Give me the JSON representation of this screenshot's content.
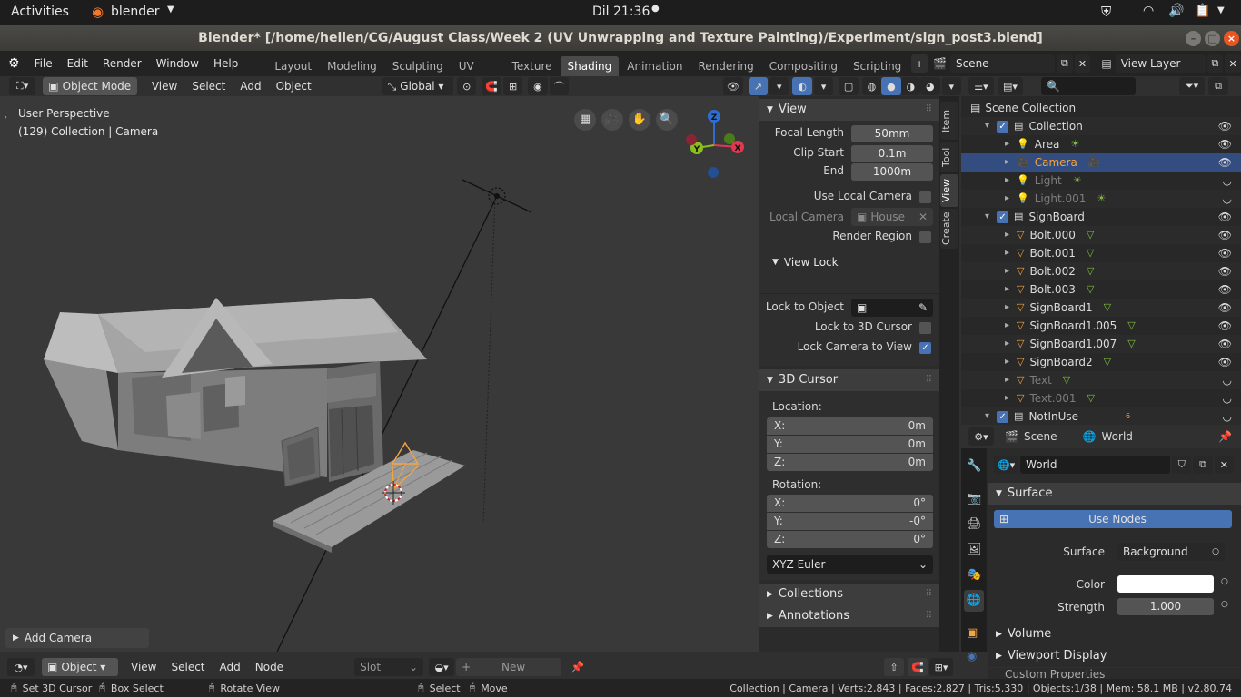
{
  "topbar": {
    "activities": "Activities",
    "app": "blender",
    "clock": "Dil 21:36"
  },
  "window": {
    "title": "Blender* [/home/hellen/CG/August Class/Week 2 (UV Unwrapping and Texture Painting)/Experiment/sign_post3.blend]"
  },
  "menu": {
    "items": [
      "File",
      "Edit",
      "Render",
      "Window",
      "Help"
    ]
  },
  "workspaces": {
    "tabs": [
      "Layout",
      "Modeling",
      "Sculpting",
      "UV Editing",
      "Texture Paint",
      "Shading",
      "Animation",
      "Rendering",
      "Compositing",
      "Scripting"
    ],
    "active": "Shading"
  },
  "scene": {
    "label": "Scene",
    "view_layer": "View Layer"
  },
  "viewport_header": {
    "mode": "Object Mode",
    "items": [
      "View",
      "Select",
      "Add",
      "Object"
    ],
    "transform": "Global"
  },
  "viewport": {
    "perspective": "User Perspective",
    "info": "(129) Collection | Camera",
    "last_op": "Add Camera"
  },
  "gizmo": {
    "x": "X",
    "y": "Y",
    "z": "Z"
  },
  "npanel": {
    "tabs": [
      "Item",
      "Tool",
      "View",
      "Create"
    ],
    "active_tab": "View",
    "view": {
      "title": "View",
      "focal_label": "Focal Length",
      "focal": "50mm",
      "clip_start_label": "Clip Start",
      "clip_start": "0.1m",
      "end_label": "End",
      "end": "1000m",
      "local_cam_label": "Use Local Camera",
      "local_camera_label": "Local Camera",
      "local_camera_value": "House",
      "render_region": "Render Region"
    },
    "view_lock": {
      "title": "View Lock",
      "lock_obj": "Lock to Object",
      "lock_3d": "Lock to 3D Cursor",
      "lock_cam": "Lock Camera to View"
    },
    "cursor": {
      "title": "3D Cursor",
      "location": "Location:",
      "lx": "0m",
      "ly": "0m",
      "lz": "0m",
      "rotation": "Rotation:",
      "rx": "0°",
      "ry": "-0°",
      "rz": "0°",
      "mode": "XYZ Euler",
      "x": "X:",
      "y": "Y:",
      "z": "Z:"
    },
    "collections": "Collections",
    "annotations": "Annotations"
  },
  "outliner": {
    "root": "Scene Collection",
    "rows": [
      {
        "name": "Collection",
        "indent": 0,
        "type": "coll",
        "eye": "👁"
      },
      {
        "name": "Area",
        "indent": 1,
        "type": "light",
        "eye": "👁"
      },
      {
        "name": "Camera",
        "indent": 1,
        "type": "cam",
        "eye": "👁",
        "sel": true
      },
      {
        "name": "Light",
        "indent": 1,
        "type": "light",
        "eye": "◡",
        "dim": true
      },
      {
        "name": "Light.001",
        "indent": 1,
        "type": "light",
        "eye": "◡",
        "dim": true
      },
      {
        "name": "SignBoard",
        "indent": 0,
        "type": "coll",
        "eye": "👁"
      },
      {
        "name": "Bolt.000",
        "indent": 1,
        "type": "mesh",
        "eye": "👁"
      },
      {
        "name": "Bolt.001",
        "indent": 1,
        "type": "mesh",
        "eye": "👁"
      },
      {
        "name": "Bolt.002",
        "indent": 1,
        "type": "mesh",
        "eye": "👁"
      },
      {
        "name": "Bolt.003",
        "indent": 1,
        "type": "mesh",
        "eye": "👁"
      },
      {
        "name": "SignBoard1",
        "indent": 1,
        "type": "mesh",
        "eye": "👁"
      },
      {
        "name": "SignBoard1.005",
        "indent": 1,
        "type": "mesh",
        "eye": "👁"
      },
      {
        "name": "SignBoard1.007",
        "indent": 1,
        "type": "mesh",
        "eye": "👁"
      },
      {
        "name": "SignBoard2",
        "indent": 1,
        "type": "mesh",
        "eye": "👁"
      },
      {
        "name": "Text",
        "indent": 1,
        "type": "mesh",
        "eye": "◡",
        "dim": true
      },
      {
        "name": "Text.001",
        "indent": 1,
        "type": "mesh",
        "eye": "◡",
        "dim": true
      },
      {
        "name": "NotInUse",
        "indent": 0,
        "type": "coll",
        "eye": "◡",
        "badge": "6"
      }
    ]
  },
  "properties": {
    "scene": "Scene",
    "world_tab": "World",
    "world_name": "World",
    "surface": "Surface",
    "use_nodes": "Use Nodes",
    "surface_label": "Surface",
    "surface_value": "Background",
    "color_label": "Color",
    "strength_label": "Strength",
    "strength": "1.000",
    "volume": "Volume",
    "viewport_display": "Viewport Display",
    "custom": "Custom Properties"
  },
  "node_header": {
    "mode": "Object",
    "items": [
      "View",
      "Select",
      "Add",
      "Node"
    ],
    "slot": "Slot",
    "new": "New"
  },
  "status": {
    "set_cursor": "Set 3D Cursor",
    "box_select": "Box Select",
    "rotate": "Rotate View",
    "select": "Select",
    "move": "Move",
    "stats": "Collection | Camera | Verts:2,843 | Faces:2,827 | Tris:5,330 | Objects:1/38 | Mem: 58.1 MB | v2.80.74"
  },
  "colors": {
    "accent": "#4772b3",
    "selected": "#f5a442",
    "background": "#303030"
  }
}
